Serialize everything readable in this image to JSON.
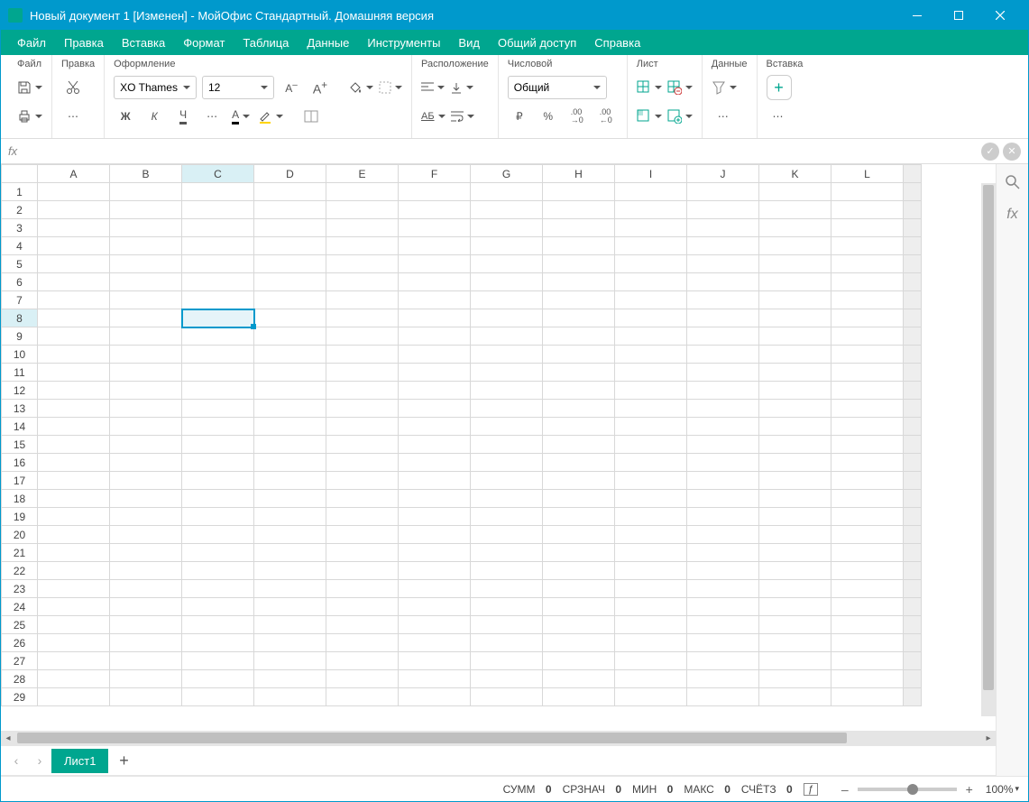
{
  "title": "Новый документ 1 [Изменен] - МойОфис Стандартный. Домашняя версия",
  "menu": [
    "Файл",
    "Правка",
    "Вставка",
    "Формат",
    "Таблица",
    "Данные",
    "Инструменты",
    "Вид",
    "Общий доступ",
    "Справка"
  ],
  "ribbon": {
    "file": {
      "label": "Файл"
    },
    "edit": {
      "label": "Правка"
    },
    "format": {
      "label": "Оформление",
      "font": "XO Thames",
      "size": "12"
    },
    "layout": {
      "label": "Расположение"
    },
    "number": {
      "label": "Числовой",
      "format": "Общий"
    },
    "sheet": {
      "label": "Лист"
    },
    "data": {
      "label": "Данные"
    },
    "insert": {
      "label": "Вставка"
    }
  },
  "columns": [
    "A",
    "B",
    "C",
    "D",
    "E",
    "F",
    "G",
    "H",
    "I",
    "J",
    "K",
    "L"
  ],
  "rows": 29,
  "selected": {
    "col": "C",
    "colIdx": 2,
    "row": 8
  },
  "sheetTab": "Лист1",
  "status": {
    "sum": {
      "label": "СУММ",
      "value": "0"
    },
    "avg": {
      "label": "СРЗНАЧ",
      "value": "0"
    },
    "min": {
      "label": "МИН",
      "value": "0"
    },
    "max": {
      "label": "МАКС",
      "value": "0"
    },
    "count": {
      "label": "СЧЁТЗ",
      "value": "0"
    },
    "fx": "ƒ",
    "zoom": "100%"
  }
}
